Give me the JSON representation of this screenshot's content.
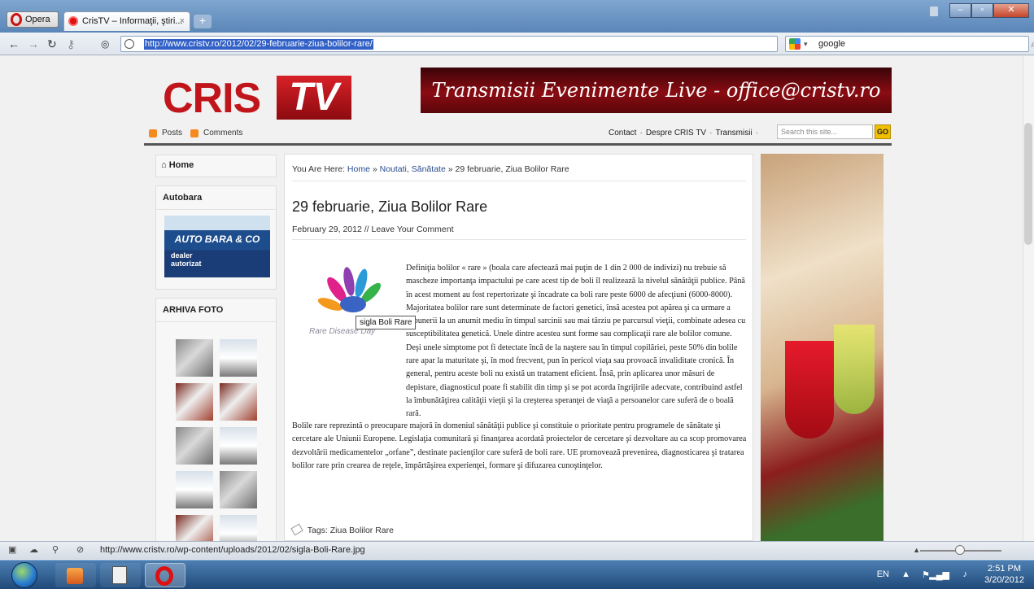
{
  "browser": {
    "menu_label": "Opera",
    "tab_title": "CrisTV – Informaţii, ştiri...",
    "tab_close": "×",
    "new_tab": "+",
    "url": "http://www.cristv.ro/2012/02/29-februarie-ziua-bolilor-rare/",
    "search_engine_text": "google",
    "window_controls": {
      "minimize": "–",
      "maximize": "▫",
      "close": "✕"
    }
  },
  "site": {
    "logo_left": "CRIS",
    "logo_right": "TV",
    "banner_text": "Transmisii Evenimente Live - office@cristv.ro",
    "feeds": {
      "posts": "Posts",
      "comments": "Comments"
    },
    "nav": {
      "contact": "Contact",
      "despre": "Despre CRIS TV",
      "transmisii": "Transmisii"
    },
    "nav_sep": "·",
    "search_placeholder": "Search this site...",
    "search_go": "GO"
  },
  "sidebar": {
    "home": "Home",
    "autobara_title": "Autobara",
    "autobara_ad": {
      "brand": "AUTO BARA & CO",
      "line1": "dealer",
      "line2": "autorizat"
    },
    "arhiva_title": "ARHIVA FOTO"
  },
  "post": {
    "breadcrumb_prefix": "You Are Here:",
    "breadcrumb_home": "Home",
    "breadcrumb_sep": "»",
    "breadcrumb_cat1": "Noutati",
    "breadcrumb_comma": ",",
    "breadcrumb_cat2": "Sănătate",
    "breadcrumb_current": "29 februarie, Ziua Bolilor Rare",
    "title": "29 februarie, Ziua Bolilor Rare",
    "date": "February 29, 2012",
    "meta_sep": "//",
    "comment_link": "Leave Your Comment",
    "image_caption": "Rare Disease Day",
    "image_tooltip": "sigla Boli Rare",
    "paragraph1": "Definiţia bolilor « rare » (boala care afectează mai puţin de 1 din 2 000 de indivizi) nu trebuie să mascheze importanţa impactului pe care acest tip de boli îl realizează la nivelul sănătăţii publice. Până în acest moment au fost repertorizate şi încadrate ca boli rare peste 6000 de afecţiuni (6000-8000). Majoritatea bolilor rare sunt determinate de factori genetici, însă acestea pot apărea şi ca urmare a expunerii la un anumit mediu în timpul sarcinii sau mai târziu pe parcursul vieţii, combinate adesea cu susceptibilitatea genetică. Unele dintre acestea sunt forme sau complicaţii rare ale bolilor comune. Deşi unele simptome pot fi detectate încă de la naştere sau în timpul copilăriei, peste 50% din bolile rare apar la maturitate şi, în mod frecvent, pun în pericol viaţa sau provoacă invaliditate cronică. În general, pentru aceste boli nu există un tratament eficient. Însă, prin aplicarea unor măsuri de depistare, diagnosticul poate fi stabilit din timp şi se pot acorda îngrijirile adecvate, contribuind astfel la îmbunătăţirea calităţii vieţii şi la creşterea speranţei de viaţă a persoanelor care suferă de o boală rară.",
    "paragraph2": "Bolile rare reprezintă o preocupare majoră în domeniul sănătăţii publice şi constituie o prioritate pentru programele de sănătate şi cercetare ale Uniunii Europene. Legislaţia comunitară şi finanţarea acordată proiectelor de cercetare şi dezvoltare au ca scop promovarea dezvoltării medicamentelor „orfane”, destinate pacienţilor care suferă de boli rare. UE promovează prevenirea, diagnosticarea şi tratarea bolilor rare prin crearea de reţele, împărtăşirea experienţei, formare şi difuzarea cunoştinţelor.",
    "tags_label": "Tags:",
    "tags_value": "Ziua Bolilor Rare"
  },
  "status_bar": {
    "url": "http://www.cristv.ro/wp-content/uploads/2012/02/sigla-Boli-Rare.jpg"
  },
  "taskbar": {
    "lang": "EN",
    "time": "2:51 PM",
    "date": "3/20/2012"
  }
}
